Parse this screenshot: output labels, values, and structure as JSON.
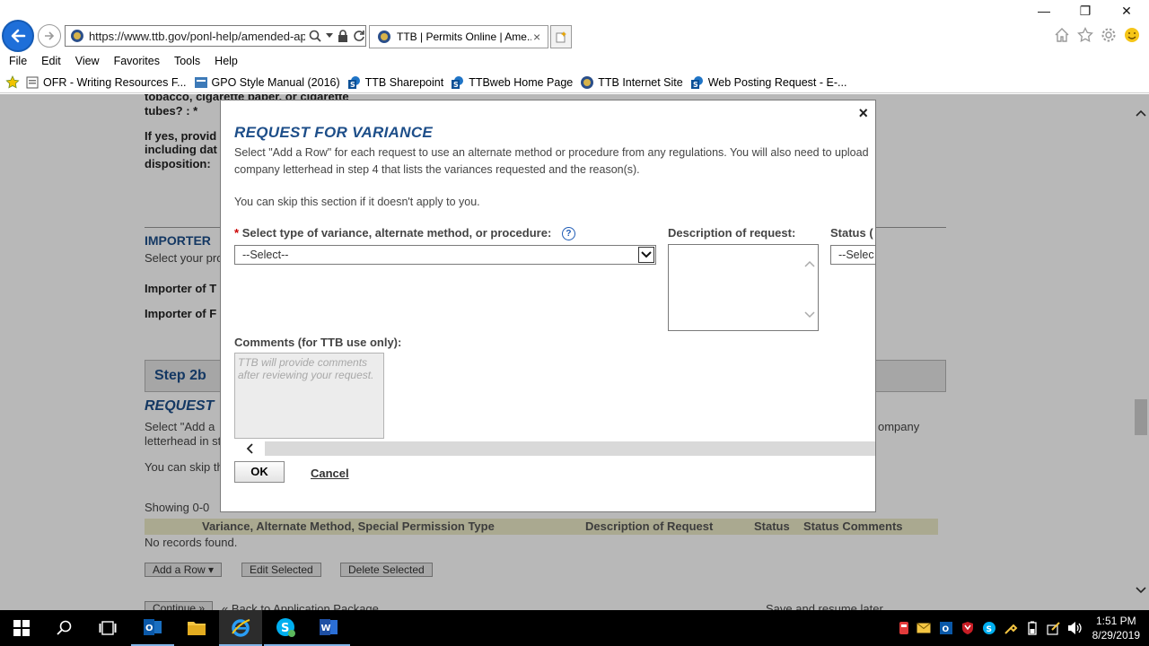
{
  "browser": {
    "url": "https://www.ttb.gov/ponl-help/amended-app",
    "tab_title": "TTB | Permits Online | Ame...",
    "tab_close": "×",
    "menu": [
      "File",
      "Edit",
      "View",
      "Favorites",
      "Tools",
      "Help"
    ],
    "favorites": [
      "OFR - Writing Resources F...",
      "GPO Style Manual (2016)",
      "TTB Sharepoint",
      "TTBweb Home Page",
      "TTB Internet Site",
      "Web Posting Request - E-..."
    ],
    "window_controls": {
      "minimize": "—",
      "maximize": "❐",
      "close": "✕"
    }
  },
  "background_page": {
    "q1_line1": "tobacco, cigarette paper, or cigarette",
    "q1_line2": "tubes? : *",
    "q2_line1": "If yes, provid",
    "q2_line2": "including dat",
    "q2_line3": "disposition:",
    "importer_heading": "IMPORTER",
    "importer_sub": "Select your pro",
    "importer_of_1": "Importer of T",
    "importer_of_2": "Importer of F",
    "step_label": "Step 2b",
    "request_heading": "REQUEST",
    "select_add_1": "Select \"Add a",
    "select_add_2": "letterhead in st",
    "company_tail": "ompany",
    "you_can_skip": "You can skip th",
    "showing": "Showing 0-0",
    "table_headers": [
      "Variance, Alternate Method, Special Permission Type",
      "Description of Request",
      "Status",
      "Status Comments"
    ],
    "no_records": "No records found.",
    "buttons": {
      "add_row": "Add a Row",
      "add_row_arrow": "▾",
      "edit_selected": "Edit Selected",
      "delete_selected": "Delete Selected"
    },
    "continue_label": "Continue »",
    "back_link": "« Back to Application Package",
    "save_resume": "Save and resume later"
  },
  "modal": {
    "close": "×",
    "title": "REQUEST FOR VARIANCE",
    "intro_line1": "Select \"Add a Row\" for each request to use an alternate method or procedure from any regulations. You will also need to upload",
    "intro_line2": "company letterhead in step 4 that lists the variances requested and the reason(s).",
    "skip_text": "You can skip this section if it doesn't apply to you.",
    "required_mark": "*",
    "type_label": "Select type of variance, alternate method, or procedure:",
    "help_mark": "?",
    "type_selected": "--Select--",
    "desc_label": "Description of request:",
    "status_label": "Status (",
    "status_selected": "--Selec",
    "comments_label": "Comments (for TTB use only):",
    "comments_placeholder": "TTB will provide comments after reviewing your request.",
    "ok": "OK",
    "cancel": "Cancel"
  },
  "taskbar": {
    "time": "1:51 PM",
    "date": "8/29/2019"
  }
}
